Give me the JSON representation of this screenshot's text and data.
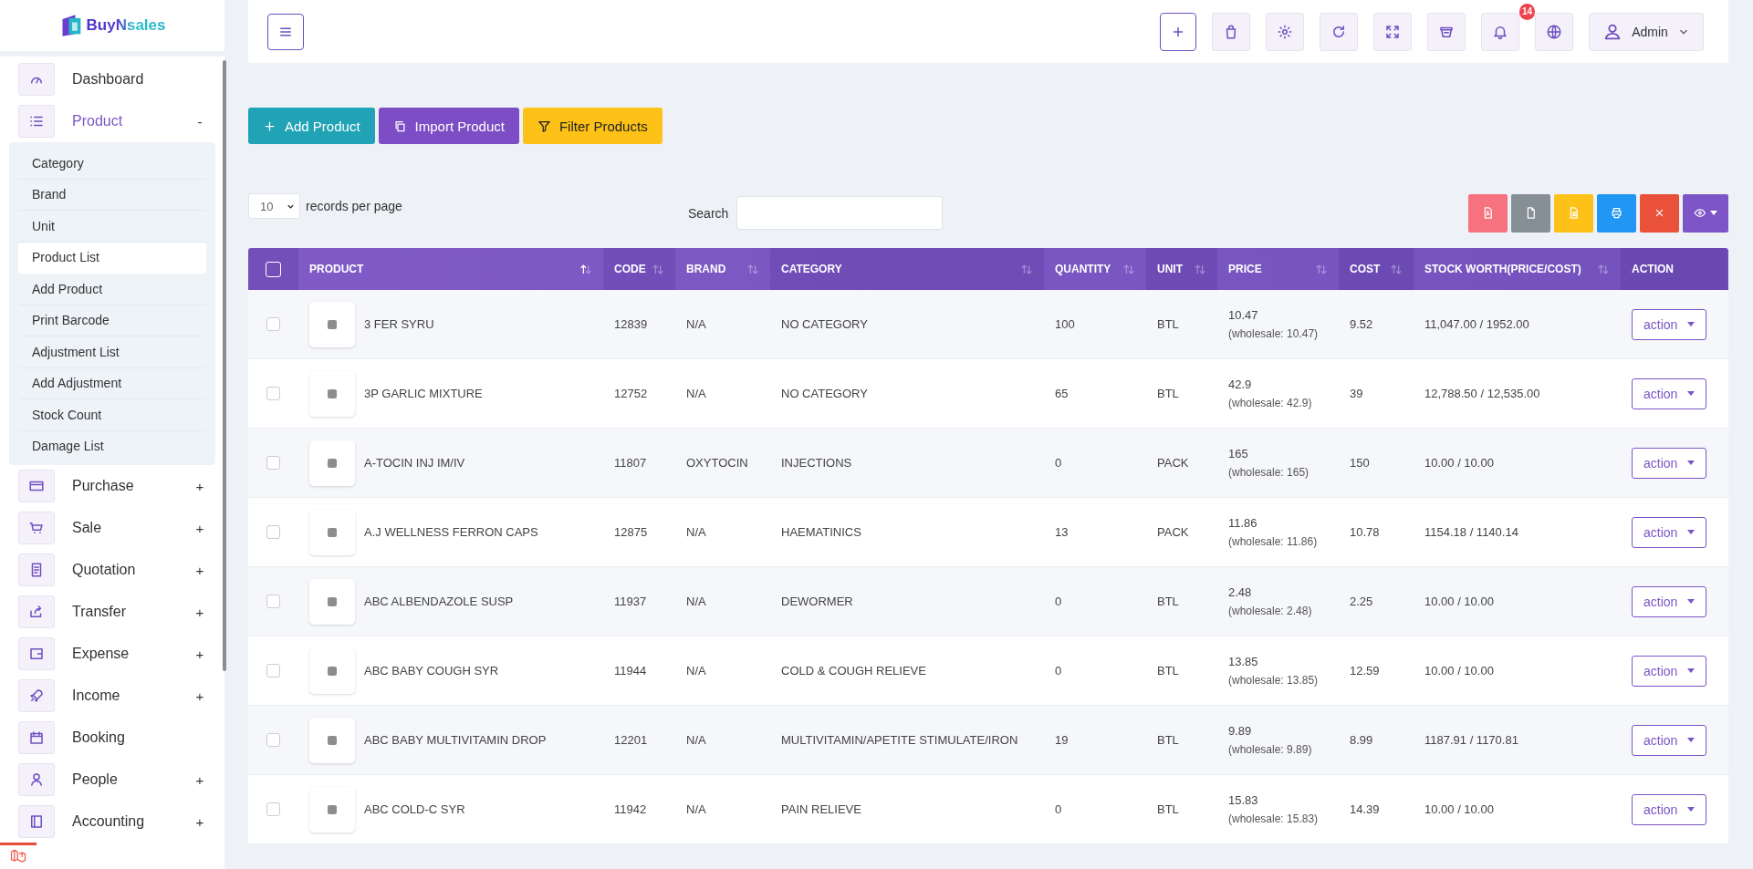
{
  "logo": {
    "text": "BuyNsales"
  },
  "sidebar": {
    "items": [
      {
        "label": "Dashboard",
        "selected": false
      },
      {
        "label": "Product",
        "toggle": "-",
        "selected": true,
        "children": [
          {
            "label": "Category",
            "selected": false
          },
          {
            "label": "Brand",
            "selected": false
          },
          {
            "label": "Unit",
            "selected": false
          },
          {
            "label": "Product List",
            "selected": true
          },
          {
            "label": "Add Product",
            "selected": false
          },
          {
            "label": "Print Barcode",
            "selected": false
          },
          {
            "label": "Adjustment List",
            "selected": false
          },
          {
            "label": "Add Adjustment",
            "selected": false
          },
          {
            "label": "Stock Count",
            "selected": false
          },
          {
            "label": "Damage List",
            "selected": false
          }
        ]
      },
      {
        "label": "Purchase",
        "toggle": "+",
        "selected": false
      },
      {
        "label": "Sale",
        "toggle": "+",
        "selected": false
      },
      {
        "label": "Quotation",
        "toggle": "+",
        "selected": false
      },
      {
        "label": "Transfer",
        "toggle": "+",
        "selected": false
      },
      {
        "label": "Expense",
        "toggle": "+",
        "selected": false
      },
      {
        "label": "Income",
        "toggle": "+",
        "selected": false
      },
      {
        "label": "Booking",
        "selected": false
      },
      {
        "label": "People",
        "toggle": "+",
        "selected": false
      },
      {
        "label": "Accounting",
        "toggle": "+",
        "selected": false
      }
    ]
  },
  "header": {
    "notifications": "14",
    "user": "Admin"
  },
  "actions": [
    "Add Product",
    "Import Product",
    "Filter Products"
  ],
  "toolbar": {
    "page_size": "10",
    "page_size_label": "records per page",
    "search_label": "Search"
  },
  "table": {
    "select_all": {
      "checked": false
    },
    "columns": [
      {
        "label": "PRODUCT",
        "sorted": true
      },
      {
        "label": "CODE",
        "sorted": false
      },
      {
        "label": "BRAND",
        "sorted": false
      },
      {
        "label": "CATEGORY",
        "sorted": false
      },
      {
        "label": "QUANTITY",
        "sorted": false
      },
      {
        "label": "UNIT",
        "sorted": false
      },
      {
        "label": "PRICE",
        "sorted": false
      },
      {
        "label": "COST",
        "sorted": false
      },
      {
        "label": "STOCK WORTH(PRICE/COST)",
        "sorted": false
      },
      {
        "label": "ACTION"
      }
    ],
    "rows": [
      {
        "checked": false,
        "product": "3 FER SYRU",
        "code": "12839",
        "brand": "N/A",
        "category": "NO CATEGORY",
        "quantity": "100",
        "unit": "BTL",
        "price": "10.47",
        "wholesale": "(wholesale: 10.47)",
        "cost": "9.52",
        "stock_worth": "11,047.00 / 1952.00",
        "action": "action"
      },
      {
        "checked": false,
        "product": "3P GARLIC MIXTURE",
        "code": "12752",
        "brand": "N/A",
        "category": "NO CATEGORY",
        "quantity": "65",
        "unit": "BTL",
        "price": "42.9",
        "wholesale": "(wholesale: 42.9)",
        "cost": "39",
        "stock_worth": "12,788.50 / 12,535.00",
        "action": "action"
      },
      {
        "checked": false,
        "product": "A-TOCIN INJ IM/IV",
        "code": "11807",
        "brand": "OXYTOCIN",
        "category": "INJECTIONS",
        "quantity": "0",
        "unit": "PACK",
        "price": "165",
        "wholesale": "(wholesale: 165)",
        "cost": "150",
        "stock_worth": "10.00 / 10.00",
        "action": "action"
      },
      {
        "checked": false,
        "product": "A.J WELLNESS FERRON CAPS",
        "code": "12875",
        "brand": "N/A",
        "category": "HAEMATINICS",
        "quantity": "13",
        "unit": "PACK",
        "price": "11.86",
        "wholesale": "(wholesale: 11.86)",
        "cost": "10.78",
        "stock_worth": "1154.18 / 1140.14",
        "action": "action"
      },
      {
        "checked": false,
        "product": "ABC ALBENDAZOLE SUSP",
        "code": "11937",
        "brand": "N/A",
        "category": "DEWORMER",
        "quantity": "0",
        "unit": "BTL",
        "price": "2.48",
        "wholesale": "(wholesale: 2.48)",
        "cost": "2.25",
        "stock_worth": "10.00 / 10.00",
        "action": "action"
      },
      {
        "checked": false,
        "product": "ABC BABY COUGH SYR",
        "code": "11944",
        "brand": "N/A",
        "category": "COLD & COUGH RELIEVE",
        "quantity": "0",
        "unit": "BTL",
        "price": "13.85",
        "wholesale": "(wholesale: 13.85)",
        "cost": "12.59",
        "stock_worth": "10.00 / 10.00",
        "action": "action"
      },
      {
        "checked": false,
        "product": "ABC BABY MULTIVITAMIN DROP",
        "code": "12201",
        "brand": "N/A",
        "category": "MULTIVITAMIN/APETITE STIMULATE/IRON",
        "quantity": "19",
        "unit": "BTL",
        "price": "9.89",
        "wholesale": "(wholesale: 9.89)",
        "cost": "8.99",
        "stock_worth": "1187.91 / 1170.81",
        "action": "action"
      },
      {
        "checked": false,
        "product": "ABC COLD-C SYR",
        "code": "11942",
        "brand": "N/A",
        "category": "PAIN RELIEVE",
        "quantity": "0",
        "unit": "BTL",
        "price": "15.83",
        "wholesale": "(wholesale: 15.83)",
        "cost": "14.39",
        "stock_worth": "10.00 / 10.00",
        "action": "action"
      }
    ]
  }
}
